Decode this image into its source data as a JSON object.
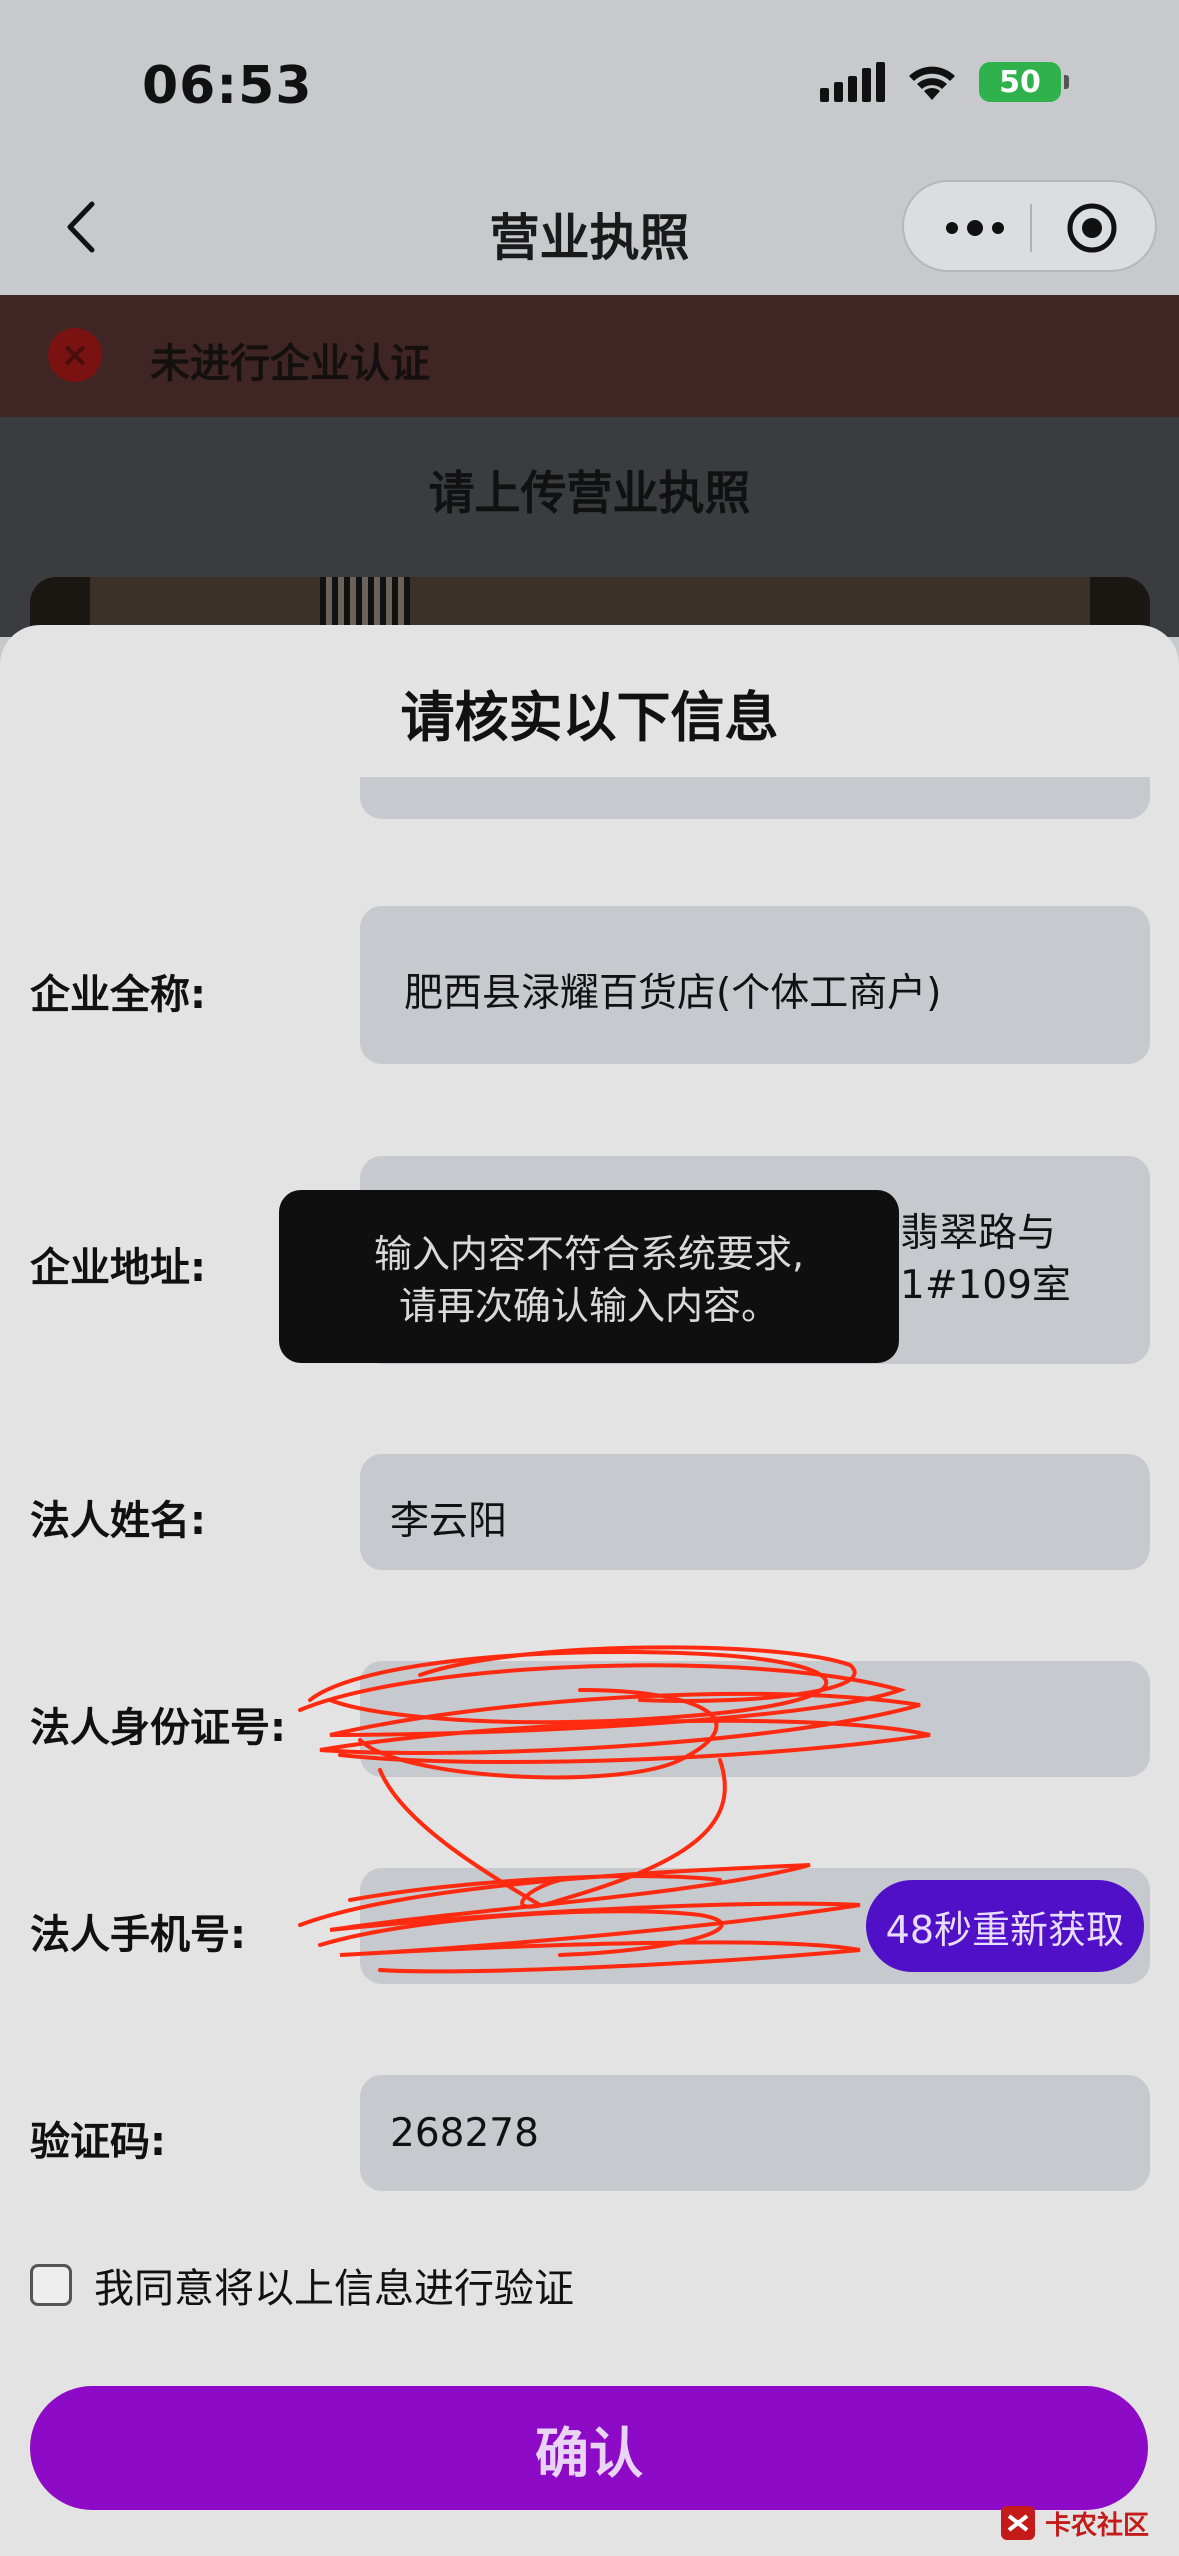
{
  "status_bar": {
    "time": "06:53",
    "battery": "50"
  },
  "nav": {
    "title": "营业执照"
  },
  "background": {
    "auth_status": "未进行企业认证",
    "upload_title": "请上传营业执照"
  },
  "sheet": {
    "title": "请核实以下信息",
    "fields": {
      "company_name": {
        "label": "企业全称:",
        "value": "肥西县渌耀百货店(个体工商户)"
      },
      "company_address": {
        "label": "企业地址:",
        "value_line1": "翡翠路与",
        "value_line2": "1#109室"
      },
      "legal_name": {
        "label": "法人姓名:",
        "value": "李云阳"
      },
      "legal_id": {
        "label": "法人身份证号:"
      },
      "legal_phone": {
        "label": "法人手机号:",
        "resend_label": "48秒重新获取"
      },
      "verify_code": {
        "label": "验证码:",
        "value": "268278"
      }
    },
    "agree_text": "我同意将以上信息进行验证",
    "confirm_label": "确认"
  },
  "toast": {
    "line1": "输入内容不符合系统要求,",
    "line2": "请再次确认输入内容。"
  },
  "watermark": {
    "text": "卡农社区"
  },
  "colors": {
    "brand_purple": "#8d0bc7",
    "resend_purple": "#5010c8",
    "scribble_red": "#ff2a10"
  }
}
